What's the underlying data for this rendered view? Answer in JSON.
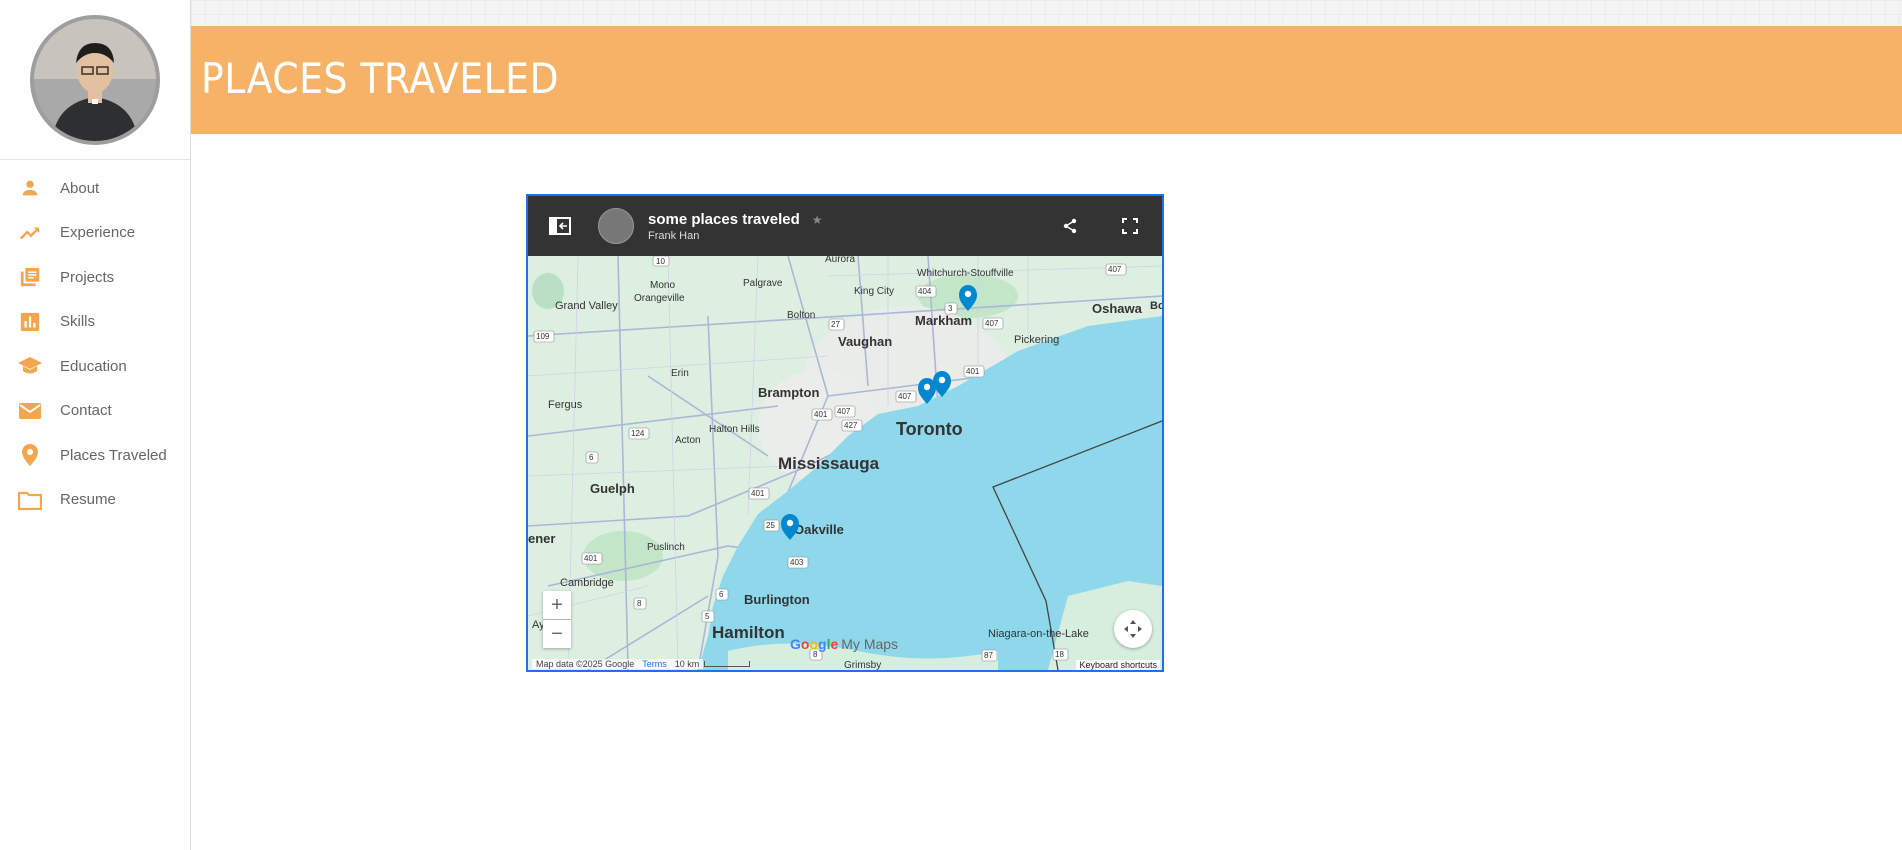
{
  "sidebar": {
    "items": [
      {
        "label": "About",
        "icon": "person-icon"
      },
      {
        "label": "Experience",
        "icon": "trending-up-icon"
      },
      {
        "label": "Projects",
        "icon": "library-books-icon"
      },
      {
        "label": "Skills",
        "icon": "bar-chart-icon"
      },
      {
        "label": "Education",
        "icon": "graduation-cap-icon"
      },
      {
        "label": "Contact",
        "icon": "mail-icon"
      },
      {
        "label": "Places Traveled",
        "icon": "place-icon"
      },
      {
        "label": "Resume",
        "icon": "folder-icon"
      }
    ]
  },
  "page": {
    "title": "PLACES TRAVELED"
  },
  "colors": {
    "accent": "#f6b368",
    "icon": "#f3a64e",
    "map_header": "#333333",
    "marker": "#0288d1",
    "water": "#8fd8ec",
    "land": "#d5eedd"
  },
  "map": {
    "title": "some places traveled",
    "owner": "Frank Han",
    "star": "★",
    "zoom_in": "+",
    "zoom_out": "−",
    "map_data": "Map data ©2025 Google",
    "terms": "Terms",
    "scale": "10 km",
    "keyboard_shortcuts": "Keyboard shortcuts",
    "logo_google": [
      "G",
      "o",
      "o",
      "g",
      "l",
      "e"
    ],
    "logo_suffix": "My Maps",
    "labels": {
      "aurora": "Aurora",
      "whitchurch": "Whitchurch-Stouffville",
      "mono": "Mono",
      "palgrave": "Palgrave",
      "king_city": "King City",
      "grand_valley": "Grand Valley",
      "orangeville": "Orangeville",
      "bolton": "Bolton",
      "markham": "Markham",
      "oshawa": "Oshawa",
      "vaughan": "Vaughan",
      "pickering": "Pickering",
      "erin": "Erin",
      "brampton": "Brampton",
      "fergus": "Fergus",
      "toronto": "Toronto",
      "halton_hills": "Halton Hills",
      "acton": "Acton",
      "mississauga": "Mississauga",
      "guelph": "Guelph",
      "oakville": "Oakville",
      "kitchener": "ener",
      "puslinch": "Puslinch",
      "cambridge": "Cambridge",
      "burlington": "Burlington",
      "ayr": "Ay",
      "hamilton": "Hamilton",
      "niagara": "Niagara-on-the-Lake",
      "grimsby": "Grimsby",
      "bo": "Bo"
    },
    "shields": [
      "10",
      "404",
      "407",
      "407",
      "109",
      "27",
      "3",
      "407",
      "401",
      "401",
      "407",
      "427",
      "124",
      "6",
      "401",
      "25",
      "403",
      "401",
      "6",
      "8",
      "5",
      "8",
      "87",
      "18"
    ]
  }
}
